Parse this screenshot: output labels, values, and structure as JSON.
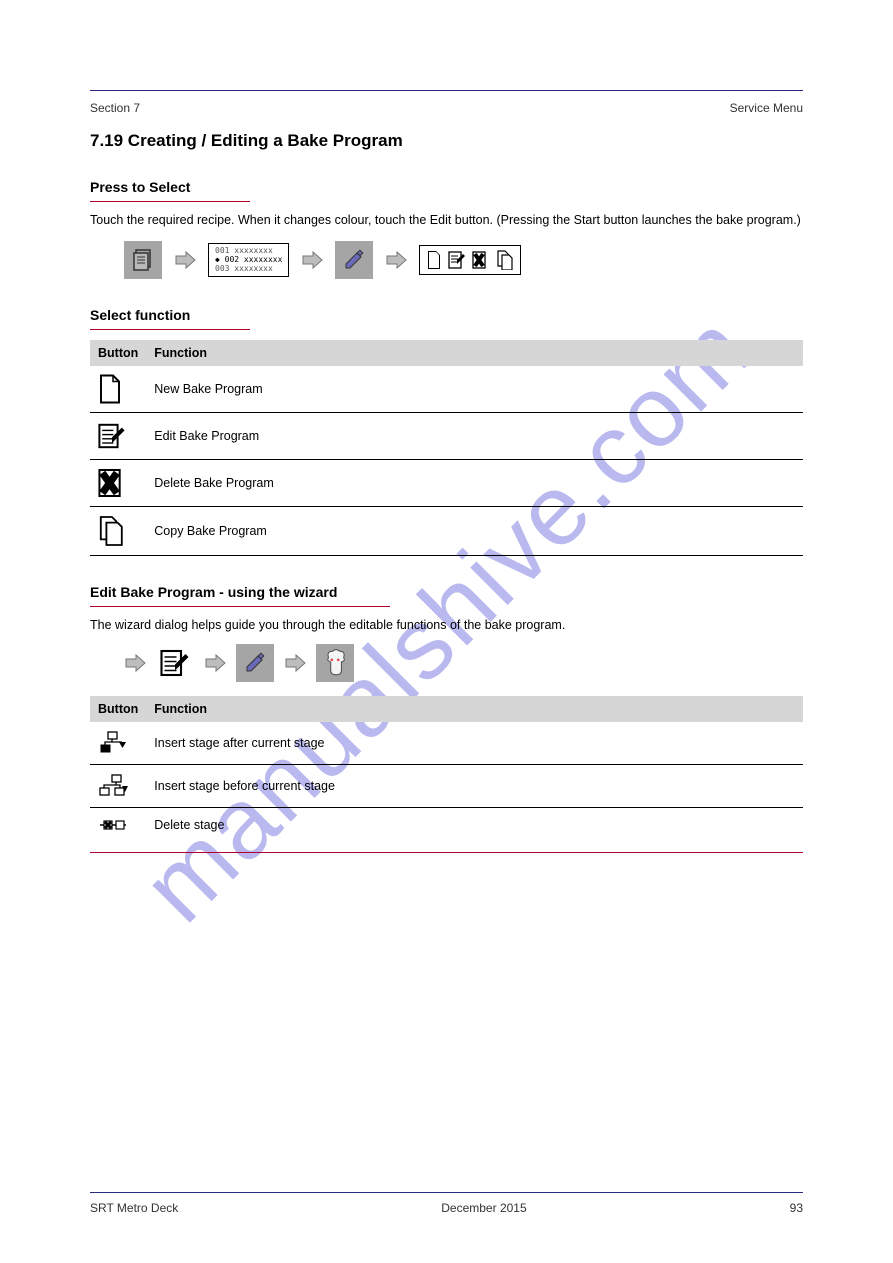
{
  "header": {
    "left": "Section 7",
    "right": "Service Menu"
  },
  "title": "7.19  Creating / Editing a Bake Program",
  "section1": {
    "heading": "Press to Select",
    "text": "Touch the required recipe. When it changes colour, touch the Edit button. (Pressing the Start button launches the bake program.)"
  },
  "listbox": {
    "rows": [
      "001 xxxxxxxx",
      "002 xxxxxxxx",
      "003 xxxxxxxx"
    ]
  },
  "section2": {
    "heading": "Select function"
  },
  "funcs": [
    {
      "icon": "page-new-icon",
      "label": "New Bake Program"
    },
    {
      "icon": "page-edit-icon",
      "label": "Edit Bake Program"
    },
    {
      "icon": "page-delete-icon",
      "label": "Delete Bake Program"
    },
    {
      "icon": "page-copy-icon",
      "label": "Copy Bake Program"
    }
  ],
  "section3": {
    "heading": "Edit Bake Program - using the wizard",
    "text": "The wizard dialog helps guide you through the editable functions of the bake program."
  },
  "wizfuncs": [
    {
      "icon": "node-insert-icon",
      "label": "Insert stage after current stage"
    },
    {
      "icon": "node-before-icon",
      "label": "Insert stage before current stage"
    },
    {
      "icon": "node-delete-icon",
      "label": "Delete stage"
    }
  ],
  "footer": {
    "left": "SRT Metro Deck",
    "center": "December 2015",
    "right": "93"
  },
  "watermark": "manualshive.com"
}
